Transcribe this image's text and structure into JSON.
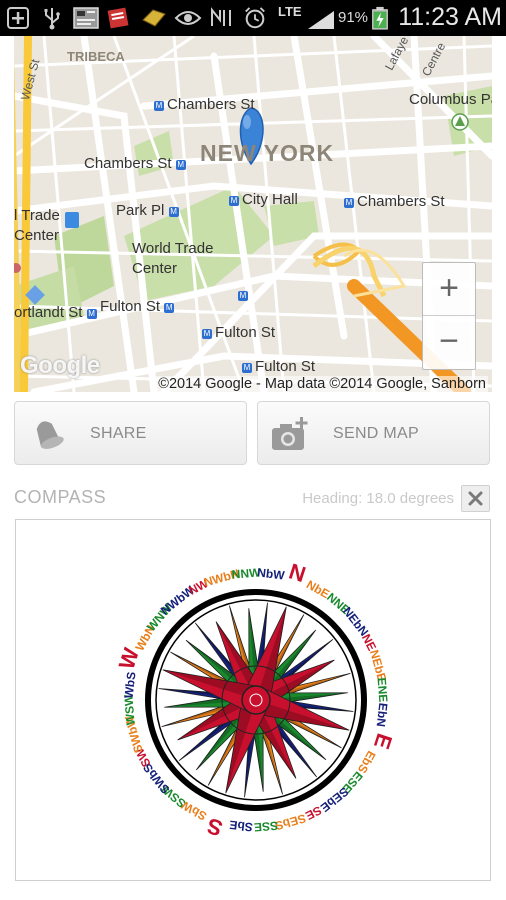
{
  "status_bar": {
    "network": "LTE",
    "battery": "91%",
    "time": "11:23 AM"
  },
  "map": {
    "labels": {
      "tribeca": "TRIBECA",
      "west_st": "West St",
      "new_york": "NEW YORK",
      "chambers_st_1": "Chambers St",
      "chambers_st_2": "Chambers St",
      "chambers_st_3": "Chambers St",
      "trade_center_a": "l Trade",
      "trade_center_b": "Center",
      "park_pl": "Park Pl",
      "city_hall": "City Hall",
      "wtc_1": "World Trade",
      "wtc_2": "Center",
      "cortlandt_st": "ortlandt St",
      "fulton_st_1": "Fulton St",
      "fulton_st_2": "Fulton St",
      "fulton_st_3": "Fulton St",
      "lafayette": "Lafaye",
      "centre": "Centre",
      "columbus_park": "Columbus Pa"
    },
    "google_logo": "Google",
    "attribution": "©2014 Google - Map data ©2014 Google, Sanborn",
    "zoom_in": "+",
    "zoom_out": "−"
  },
  "actions": {
    "share_label": "SHARE",
    "send_map_label": "SEND MAP"
  },
  "compass": {
    "title": "COMPASS",
    "heading": "Heading: 18.0 degrees",
    "close_icon": "×",
    "points": [
      "N",
      "NbE",
      "NNE",
      "NEbN",
      "NE",
      "NEbE",
      "ENE",
      "EbN",
      "E",
      "EbS",
      "ESE",
      "SEbE",
      "SE",
      "SEbS",
      "SSE",
      "SbE",
      "S",
      "SbW",
      "SSW",
      "SWbS",
      "SW",
      "SWbW",
      "WSW",
      "WbS",
      "W",
      "WbN",
      "WNW",
      "NWbW",
      "NW",
      "NWbN",
      "NNW",
      "NbW"
    ],
    "rotation_degrees": 18.0,
    "colors": {
      "cardinal": "#c8102e",
      "intercardinal": "#c8102e",
      "half_wind": "#1a8a2e",
      "quarter_wind_a": "#e87f1a",
      "quarter_wind_b": "#14207a",
      "ring": "#000000"
    }
  }
}
